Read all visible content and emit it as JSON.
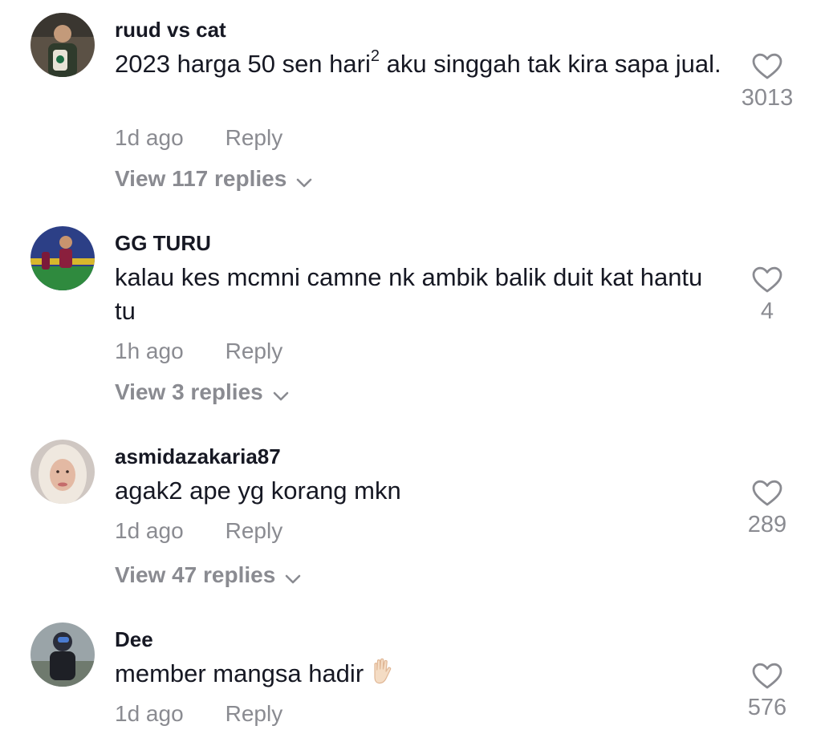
{
  "comments": [
    {
      "username": "ruud vs cat",
      "text_before": "2023 harga 50 sen hari",
      "text_sup": "2",
      "text_after": " aku singgah tak kira sapa jual.",
      "time": "1d ago",
      "reply_label": "Reply",
      "view_replies": "View 117 replies",
      "likes": "3013",
      "avatar_icon": "avatar-photo-icon"
    },
    {
      "username": "GG TURU",
      "text": "kalau kes mcmni camne nk ambik balik duit kat hantu tu",
      "time": "1h ago",
      "reply_label": "Reply",
      "view_replies": "View 3 replies",
      "likes": "4",
      "avatar_icon": "avatar-photo-icon"
    },
    {
      "username": "asmidazakaria87",
      "text": "agak2 ape yg korang mkn",
      "time": "1d ago",
      "reply_label": "Reply",
      "view_replies": "View 47 replies",
      "likes": "289",
      "avatar_icon": "avatar-photo-icon"
    },
    {
      "username": "Dee",
      "text": "member mangsa hadir",
      "emoji": "raised-hand-emoji",
      "time": "1d ago",
      "reply_label": "Reply",
      "likes": "576",
      "avatar_icon": "avatar-photo-icon"
    }
  ],
  "icons": {
    "like": "heart-outline-icon",
    "expand": "chevron-down-icon"
  },
  "colors": {
    "primary_text": "#161823",
    "secondary_text": "#8a8b91"
  }
}
